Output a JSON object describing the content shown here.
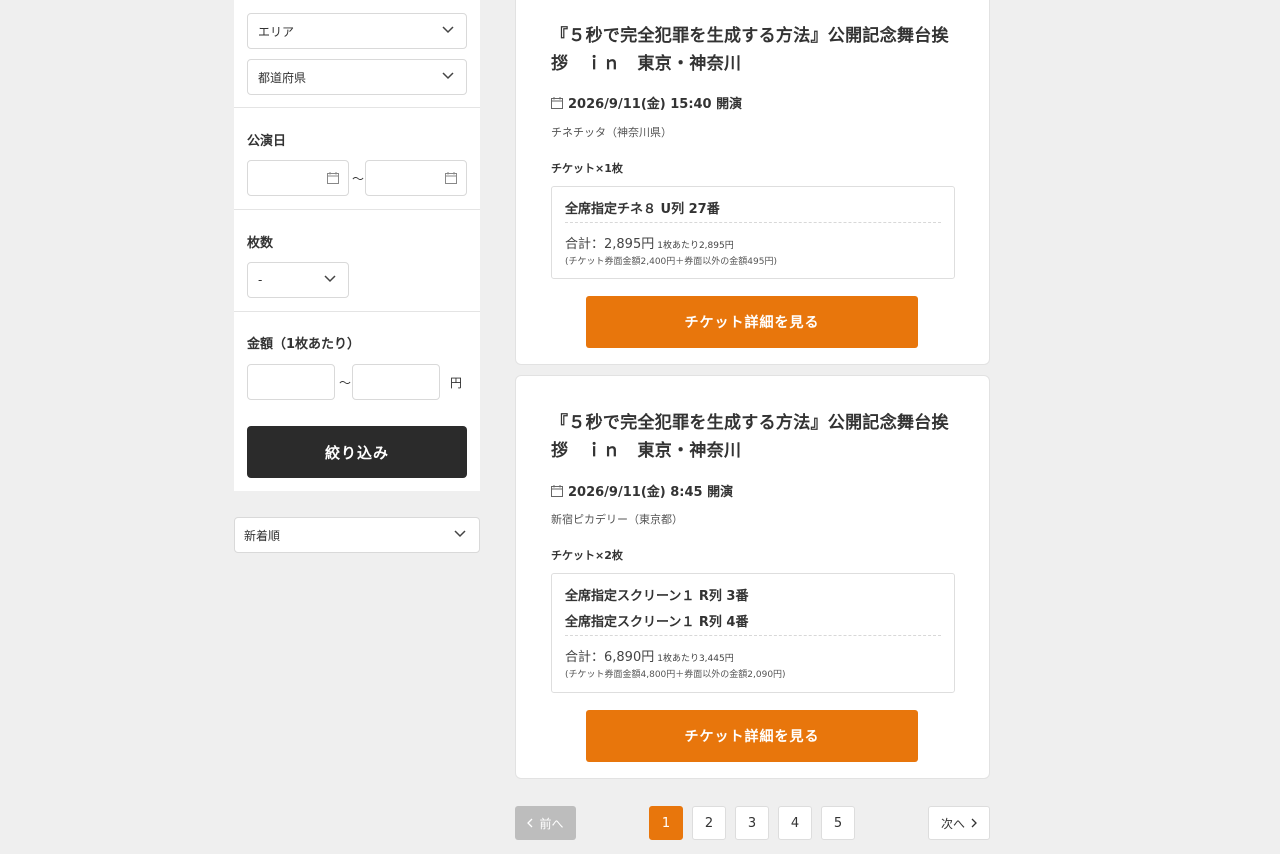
{
  "sidebar": {
    "area_select": "エリア",
    "prefecture_select": "都道府県",
    "date_label": "公演日",
    "date_sep": "～",
    "count_label": "枚数",
    "count_select": "-",
    "price_label": "金額（1枚あたり）",
    "price_sep": "～",
    "price_unit": "円",
    "filter_button": "絞り込み"
  },
  "sort": {
    "selected": "新着順"
  },
  "listings": [
    {
      "title_line1": "『５秒で完全犯罪を生成する方法』公開記念舞台挨",
      "title_line2": "拶　ｉｎ　東京・神奈川",
      "datetime": "2026/9/11(金) 15:40 開演",
      "venue": "チネチッタ（神奈川県）",
      "ticket_count": "チケット×1枚",
      "seats": [
        "全席指定チネ８ U列 27番"
      ],
      "total": "合計：2,895円",
      "per_ticket": "1枚あたり2,895円",
      "breakdown": "(チケット券面金額2,400円＋券面以外の金額495円)",
      "button": "チケット詳細を見る"
    },
    {
      "title_line1": "『５秒で完全犯罪を生成する方法』公開記念舞台挨",
      "title_line2": "拶　ｉｎ　東京・神奈川",
      "datetime": "2026/9/11(金) 8:45 開演",
      "venue": "新宿ピカデリー（東京都）",
      "ticket_count": "チケット×2枚",
      "seats": [
        "全席指定スクリーン１ R列 3番",
        "全席指定スクリーン１ R列 4番"
      ],
      "total": "合計：6,890円",
      "per_ticket": "1枚あたり3,445円",
      "breakdown": "(チケット券面金額4,800円＋券面以外の金額2,090円)",
      "button": "チケット詳細を見る"
    }
  ],
  "pagination": {
    "prev": "前へ",
    "next": "次へ",
    "pages": [
      "1",
      "2",
      "3",
      "4",
      "5"
    ],
    "current": "1"
  },
  "colors": {
    "accent": "#e8760c",
    "dark_button": "#2b2b2b",
    "disabled": "#bdbdbd"
  }
}
